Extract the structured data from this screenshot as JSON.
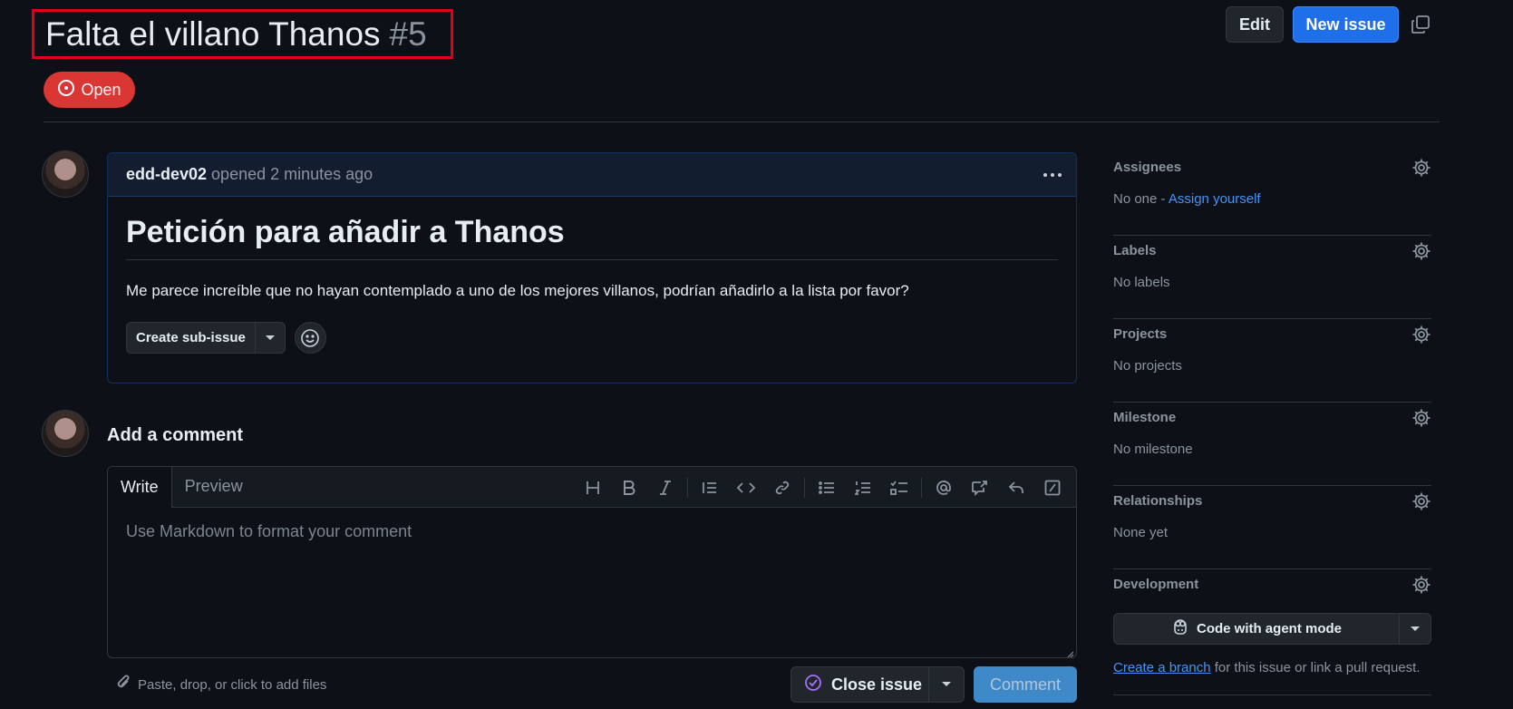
{
  "header": {
    "title": "Falta el villano Thanos",
    "number": "#5",
    "edit_label": "Edit",
    "new_issue_label": "New issue",
    "state_label": "Open"
  },
  "issue": {
    "author": "edd-dev02",
    "meta": "opened 2 minutes ago",
    "heading": "Petición para añadir a Thanos",
    "body": "Me parece increíble que no hayan contemplado a uno de los mejores villanos, podrían añadirlo a la lista por favor?",
    "create_subissue_label": "Create sub-issue"
  },
  "comment": {
    "heading": "Add a comment",
    "tabs": [
      "Write",
      "Preview"
    ],
    "placeholder": "Use Markdown to format your comment",
    "attach_hint": "Paste, drop, or click to add files",
    "close_issue_label": "Close issue",
    "comment_label": "Comment"
  },
  "sidebar": {
    "assignees": {
      "title": "Assignees",
      "value": "No one - ",
      "link": "Assign yourself"
    },
    "labels": {
      "title": "Labels",
      "value": "No labels"
    },
    "projects": {
      "title": "Projects",
      "value": "No projects"
    },
    "milestone": {
      "title": "Milestone",
      "value": "No milestone"
    },
    "relationships": {
      "title": "Relationships",
      "value": "None yet"
    },
    "development": {
      "title": "Development",
      "agent_button": "Code with agent mode",
      "branch_link": "Create a branch",
      "branch_text": " for this issue or link a pull request."
    }
  },
  "colors": {
    "background": "#0d1117",
    "open_badge": "#da3633",
    "primary_button": "#1f6feb",
    "link": "#4493f8",
    "highlight_box": "#e0001a"
  }
}
